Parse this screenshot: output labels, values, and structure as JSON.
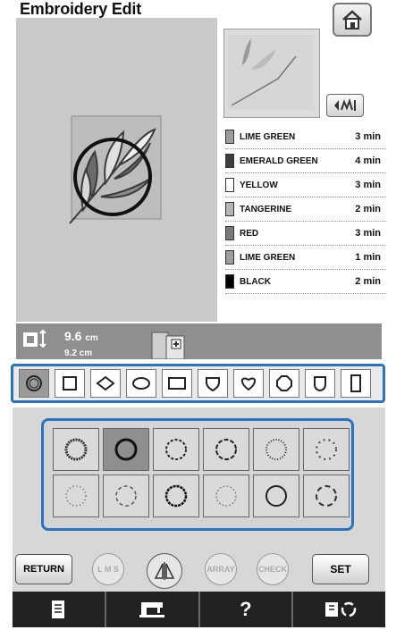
{
  "header": {
    "title": "Embroidery Edit"
  },
  "threads": [
    {
      "name": "LIME GREEN",
      "time": "3 min",
      "color": "#9c9c9c"
    },
    {
      "name": "EMERALD GREEN",
      "time": "4 min",
      "color": "#3d3d3d"
    },
    {
      "name": "YELLOW",
      "time": "3 min",
      "color": "#ffffff"
    },
    {
      "name": "TANGERINE",
      "time": "2 min",
      "color": "#b5b5b5"
    },
    {
      "name": "RED",
      "time": "3 min",
      "color": "#7a7a7a"
    },
    {
      "name": "LIME GREEN",
      "time": "1 min",
      "color": "#9c9c9c"
    },
    {
      "name": "BLACK",
      "time": "2 min",
      "color": "#000000"
    }
  ],
  "size": {
    "width": "9.6",
    "unit": "cm",
    "height": "9.2 cm"
  },
  "frame_shapes": [
    "circle-frame",
    "square-frame",
    "diamond-frame",
    "oval-frame",
    "rectangle-frame",
    "shield-frame",
    "heart-frame",
    "octagon-frame",
    "rounded-shield-frame",
    "tall-rectangle-frame"
  ],
  "stitch_styles": [
    "stitch-1",
    "stitch-2",
    "stitch-3",
    "stitch-4",
    "stitch-5",
    "stitch-6",
    "stitch-7",
    "stitch-8",
    "stitch-9",
    "stitch-10",
    "stitch-11",
    "stitch-12"
  ],
  "buttons": {
    "return": "RETURN",
    "lms": "L M S",
    "array": "ARRAY",
    "check": "CHECK",
    "set": "SET"
  },
  "nav": {
    "help": "?"
  },
  "colors": {
    "accent": "#2b73c2"
  }
}
